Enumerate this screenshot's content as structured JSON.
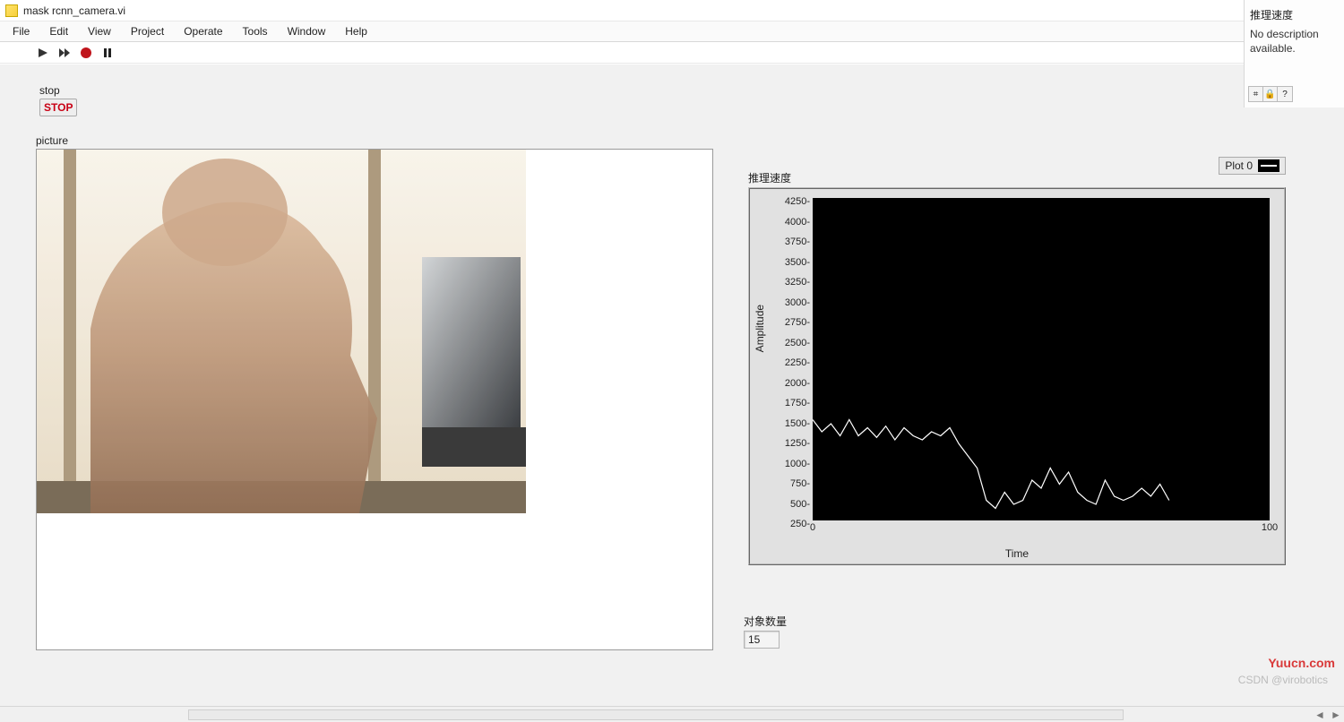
{
  "window": {
    "title": "mask rcnn_camera.vi"
  },
  "menu": [
    "File",
    "Edit",
    "View",
    "Project",
    "Operate",
    "Tools",
    "Window",
    "Help"
  ],
  "stop": {
    "label": "stop",
    "button": "STOP"
  },
  "picture": {
    "label": "picture"
  },
  "chart": {
    "title": "推理速度",
    "legend": "Plot 0",
    "ylabel": "Amplitude",
    "xlabel": "Time"
  },
  "objcount": {
    "label": "对象数量",
    "value": "15"
  },
  "info": {
    "title": "推理速度",
    "desc": "No description available."
  },
  "watermark_a": "CSDN @virobotics",
  "watermark_b": "Yuucn.com",
  "chart_data": {
    "type": "line",
    "xlabel": "Time",
    "ylabel": "Amplitude",
    "xlim": [
      0,
      100
    ],
    "ylim": [
      250,
      4250
    ],
    "yticks": [
      4250,
      4000,
      3750,
      3500,
      3250,
      3000,
      2750,
      2500,
      2250,
      2000,
      1750,
      1500,
      1250,
      1000,
      750,
      500,
      250
    ],
    "xticks": [
      0,
      100
    ],
    "series": [
      {
        "name": "Plot 0",
        "x": [
          0,
          2,
          4,
          6,
          8,
          10,
          12,
          14,
          16,
          18,
          20,
          22,
          24,
          26,
          28,
          30,
          32,
          34,
          36,
          38,
          40,
          42,
          44,
          46,
          48,
          50,
          52,
          54,
          56,
          58,
          60,
          62,
          64,
          66,
          68,
          70,
          72,
          74,
          76,
          78
        ],
        "values": [
          1500,
          1350,
          1450,
          1300,
          1500,
          1300,
          1400,
          1280,
          1420,
          1250,
          1400,
          1300,
          1250,
          1350,
          1300,
          1400,
          1200,
          1050,
          900,
          500,
          400,
          600,
          450,
          500,
          750,
          650,
          900,
          700,
          850,
          600,
          500,
          450,
          750,
          550,
          500,
          550,
          650,
          550,
          700,
          500
        ]
      }
    ]
  }
}
